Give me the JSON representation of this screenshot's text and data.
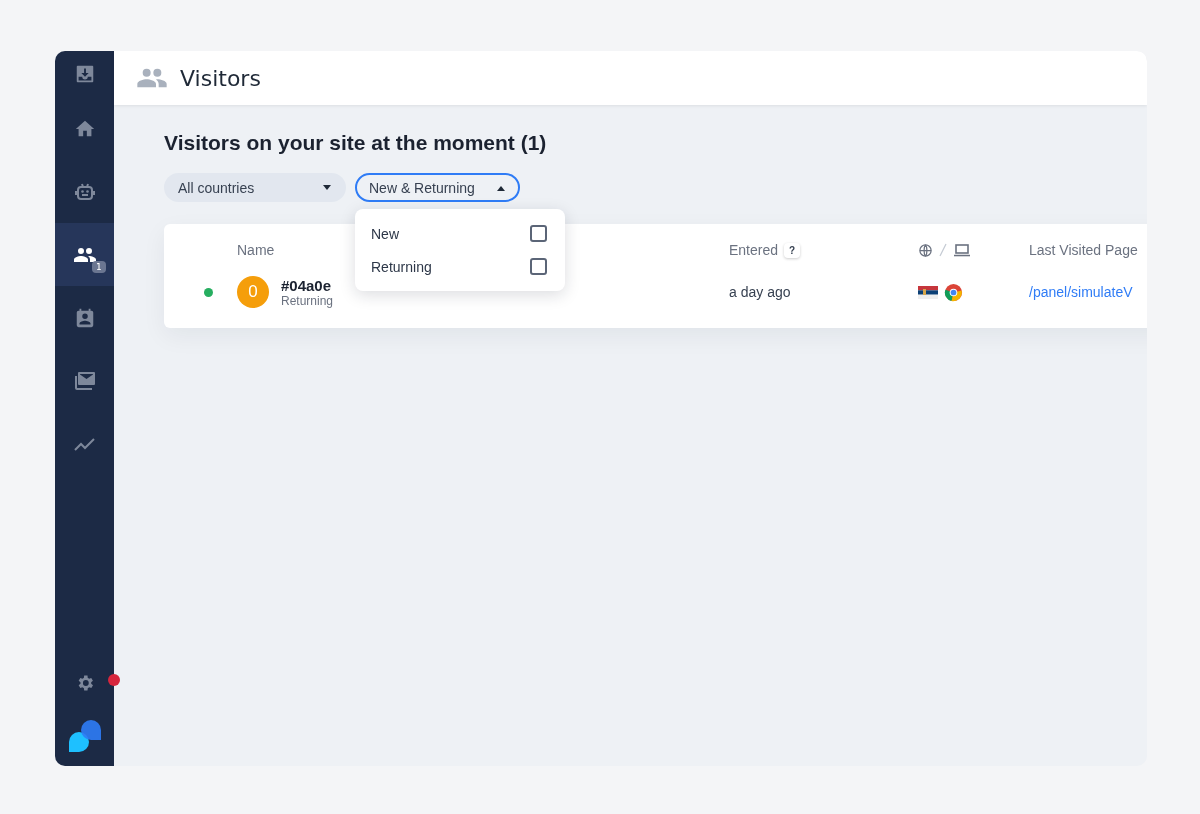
{
  "sidebar": {
    "items": [
      {
        "kind": "inbox",
        "selected": false
      },
      {
        "kind": "home",
        "selected": false
      },
      {
        "kind": "bot",
        "selected": false
      },
      {
        "kind": "visitors",
        "selected": true,
        "badge": "1"
      },
      {
        "kind": "contacts",
        "selected": false
      },
      {
        "kind": "campaigns",
        "selected": false
      },
      {
        "kind": "analytics",
        "selected": false
      }
    ],
    "bottom": {
      "settings_alert": true
    }
  },
  "header": {
    "title": "Visitors"
  },
  "heading": "Visitors on your site at the moment (1)",
  "filters": [
    {
      "kind": "country",
      "label": "All countries",
      "expanded": false
    },
    {
      "kind": "type",
      "label": "New & Returning",
      "expanded": true,
      "options": [
        {
          "label": "New",
          "checked": false
        },
        {
          "label": "Returning",
          "checked": false
        }
      ]
    }
  ],
  "table": {
    "columns": [
      "Name",
      "Entered",
      "Last Visited Page"
    ],
    "entered_help": "?",
    "rows": [
      {
        "online": true,
        "avatar": "0",
        "name": "#04a0e",
        "type": "Returning",
        "entered": "a day ago",
        "last_page": "/panel/simulateV"
      }
    ]
  }
}
